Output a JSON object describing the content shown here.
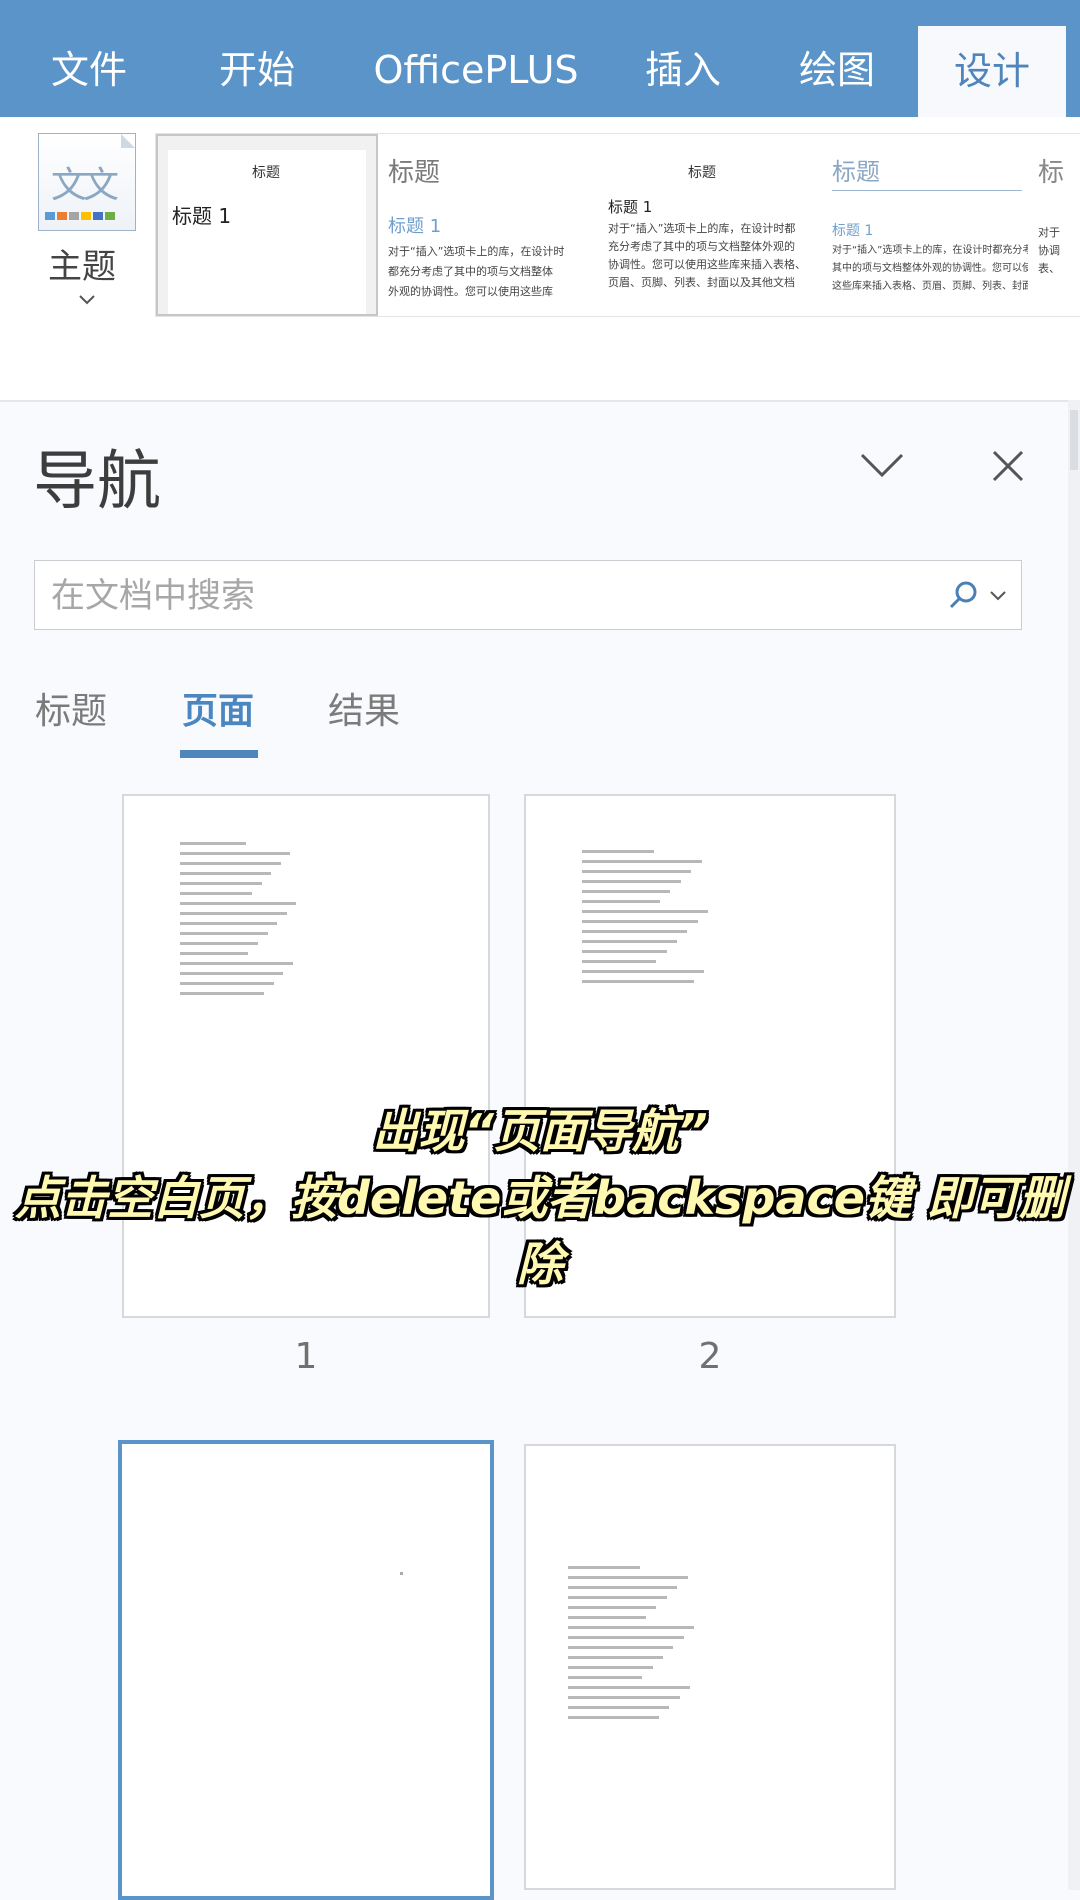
{
  "tabs": [
    {
      "label": "文件"
    },
    {
      "label": "开始"
    },
    {
      "label": "OfficePLUS"
    },
    {
      "label": "插入"
    },
    {
      "label": "绘图"
    },
    {
      "label": "设计",
      "active": true
    }
  ],
  "ribbon": {
    "theme_label": "主题",
    "theme_glyph": "文文",
    "chevron": "⌄",
    "styles": [
      {
        "title": "标题",
        "heading": "标题 1",
        "body": "",
        "selected": true
      },
      {
        "title": "标题",
        "heading": "标题 1",
        "body": "对于“插入”选项卡上的库，在设计时\n都充分考虑了其中的项与文档整体\n外观的协调性。您可以使用这些库"
      },
      {
        "title": "标题",
        "heading": "标题 1",
        "body": "对于“插入”选项卡上的库，在设计时都\n充分考虑了其中的项与文档整体外观的\n协调性。您可以使用这些库来插入表格、\n页眉、页脚、列表、封面以及其他文档"
      },
      {
        "title": "标题",
        "heading": "标题 1",
        "body": "对于“插入”选项卡上的库，在设计时都充分考虑了\n其中的项与文档整体外观的协调性。您可以使用\n这些库来插入表格、页眉、页脚、列表、封面"
      },
      {
        "title": "标",
        "heading": "",
        "body": "对于\n协调\n表、"
      }
    ]
  },
  "nav": {
    "title": "导航",
    "search_placeholder": "在文档中搜索",
    "tabs": [
      {
        "label": "标题"
      },
      {
        "label": "页面",
        "active": true
      },
      {
        "label": "结果"
      }
    ],
    "pages": [
      {
        "number": "1",
        "lines": 16
      },
      {
        "number": "2",
        "lines": 14
      },
      {
        "number": "",
        "lines": 0,
        "selected": true
      },
      {
        "number": "",
        "lines": 16
      }
    ]
  },
  "caption": {
    "line1": "出现“页面导航”",
    "line2": "点击空白页，按delete或者backspace键 即可删除"
  },
  "colors": {
    "accent": "#5a94c8",
    "caption_text": "#fff8b0"
  }
}
